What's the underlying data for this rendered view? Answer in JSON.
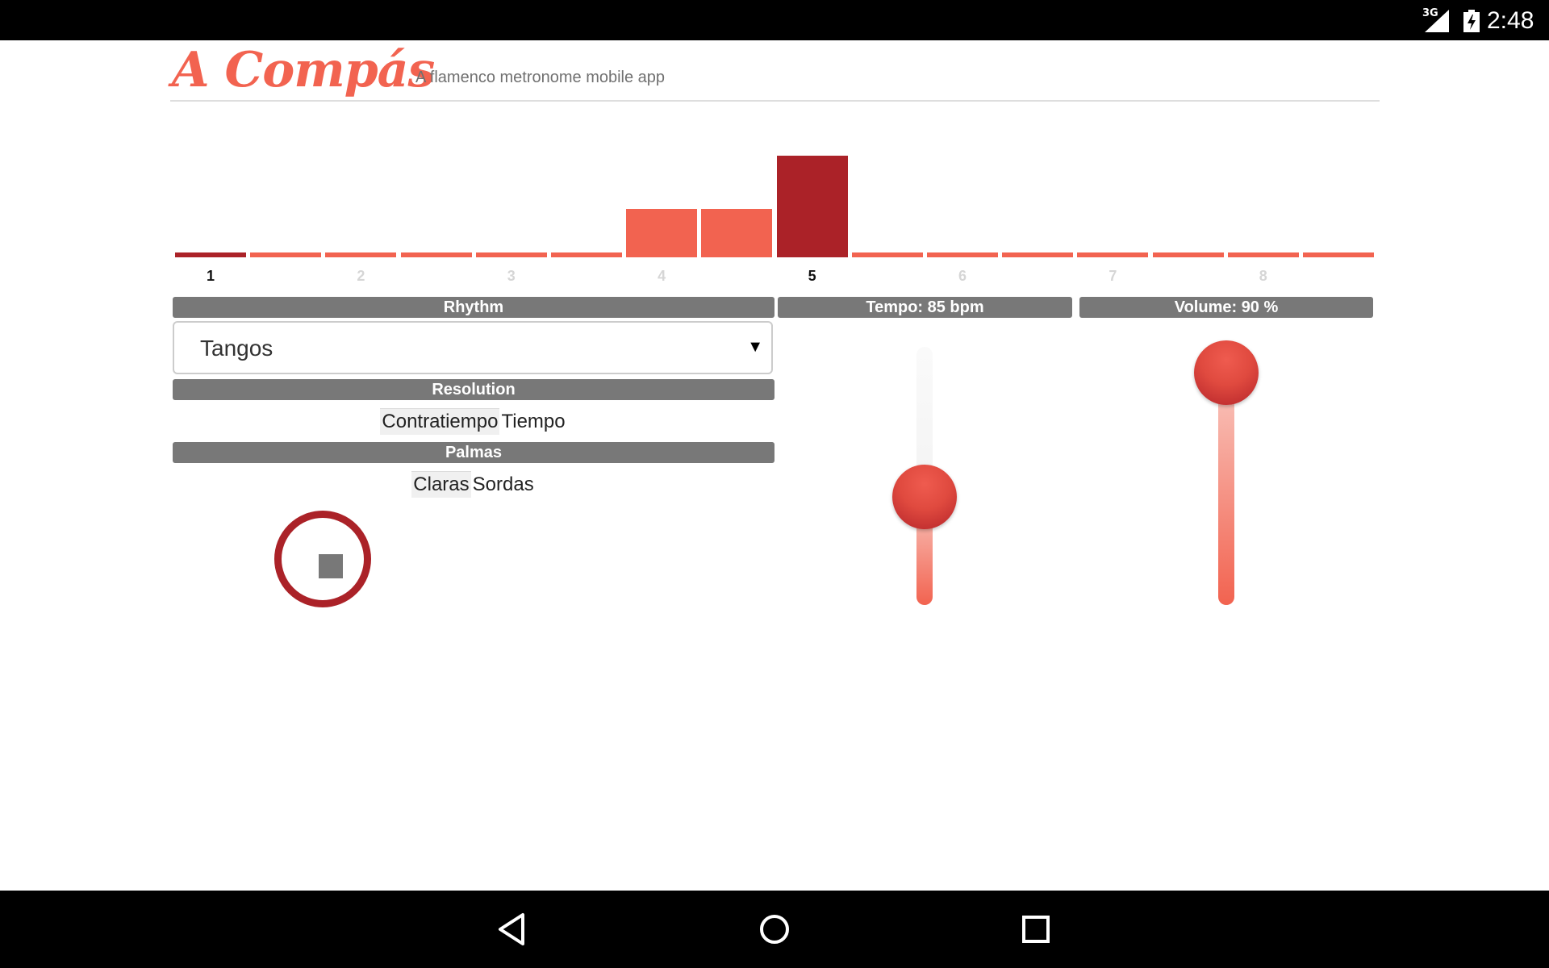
{
  "status_bar": {
    "network": "3G",
    "time": "2:48"
  },
  "header": {
    "title": "A Compás",
    "subtitle": "A flamenco metronome mobile app"
  },
  "beat_display": {
    "bars": [
      {
        "level": "hit-accent",
        "height_fraction": 0.05
      },
      {
        "level": "idle",
        "height_fraction": 0.05
      },
      {
        "level": "idle",
        "height_fraction": 0.05
      },
      {
        "level": "idle",
        "height_fraction": 0.05
      },
      {
        "level": "idle",
        "height_fraction": 0.05
      },
      {
        "level": "idle",
        "height_fraction": 0.05
      },
      {
        "level": "medium",
        "height_fraction": 0.48
      },
      {
        "level": "medium",
        "height_fraction": 0.48
      },
      {
        "level": "accent",
        "height_fraction": 1.0
      },
      {
        "level": "idle",
        "height_fraction": 0.05
      },
      {
        "level": "idle",
        "height_fraction": 0.05
      },
      {
        "level": "idle",
        "height_fraction": 0.05
      },
      {
        "level": "idle",
        "height_fraction": 0.05
      },
      {
        "level": "idle",
        "height_fraction": 0.05
      },
      {
        "level": "idle",
        "height_fraction": 0.05
      },
      {
        "level": "idle",
        "height_fraction": 0.05
      }
    ],
    "beat_numbers": [
      {
        "label": "1",
        "active": true
      },
      {
        "label": "2",
        "active": false
      },
      {
        "label": "3",
        "active": false
      },
      {
        "label": "4",
        "active": false
      },
      {
        "label": "5",
        "active": true
      },
      {
        "label": "6",
        "active": false
      },
      {
        "label": "7",
        "active": false
      },
      {
        "label": "8",
        "active": false
      }
    ]
  },
  "rhythm": {
    "header": "Rhythm",
    "selected": "Tangos",
    "arrow": "▼"
  },
  "resolution": {
    "header": "Resolution",
    "options": [
      "Contratiempo",
      "Tiempo"
    ],
    "selected": "Contratiempo"
  },
  "palmas": {
    "header": "Palmas",
    "options": [
      "Claras",
      "Sordas"
    ],
    "selected": "Claras"
  },
  "playback": {
    "state": "playing",
    "icon": "stop-icon"
  },
  "tempo": {
    "header": "Tempo: 85 bpm",
    "value_fraction": 0.42
  },
  "volume": {
    "header": "Volume: 90 %",
    "value_fraction": 0.9
  },
  "colors": {
    "brand": "#f26350",
    "accent_dark": "#ab2228",
    "bar_medium": "#f26350",
    "header_gray": "#787878"
  }
}
